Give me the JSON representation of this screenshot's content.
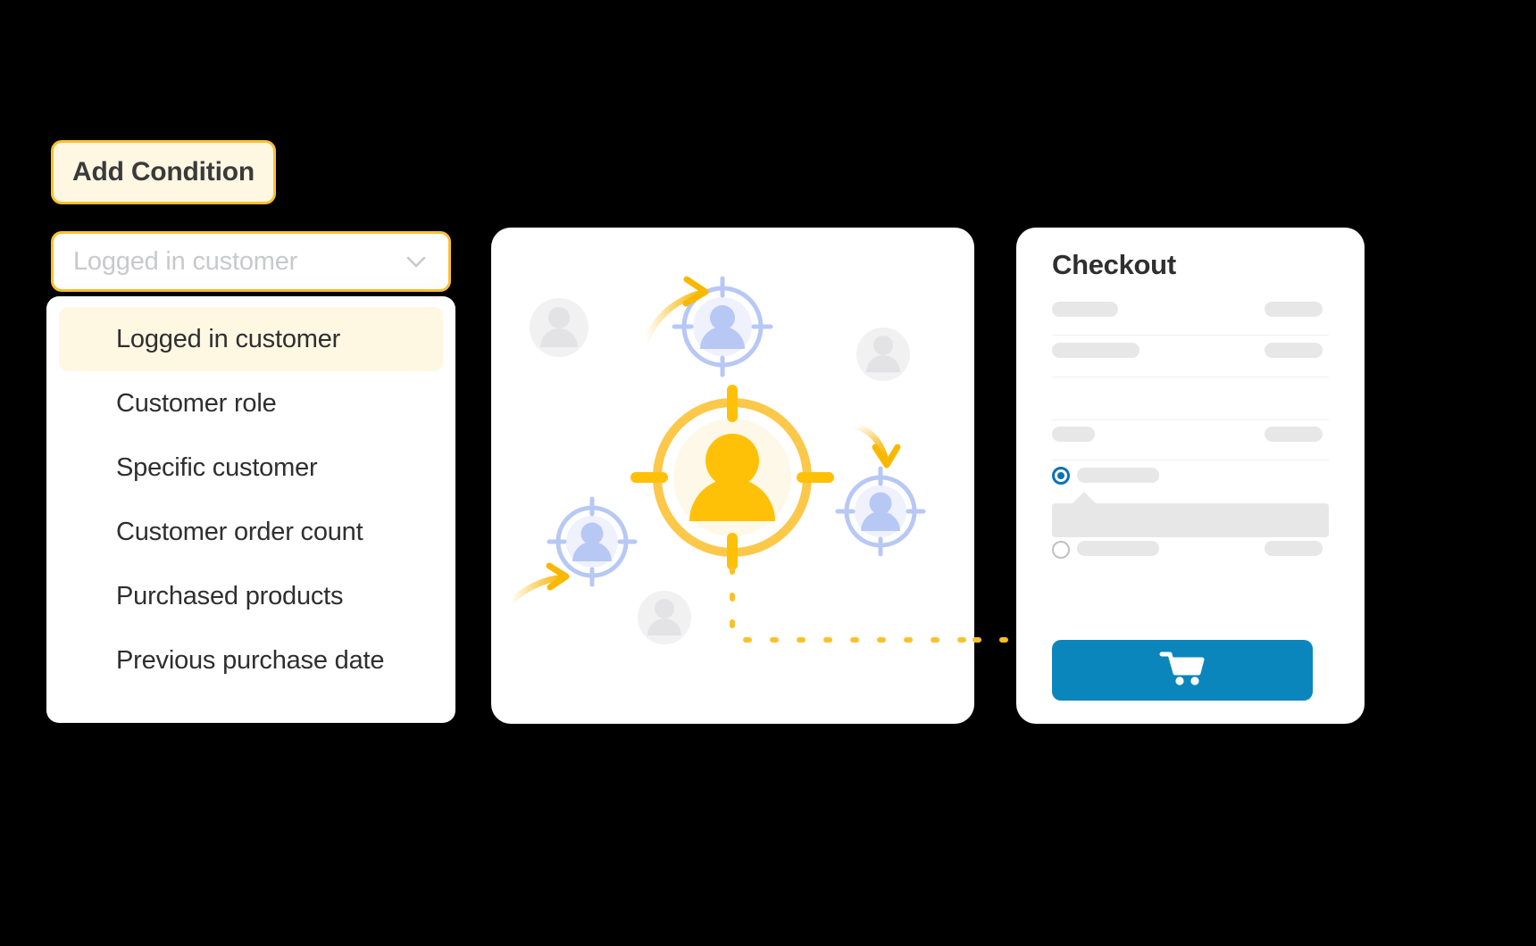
{
  "condition_builder": {
    "add_button_label": "Add Condition",
    "select": {
      "value": "Logged in customer",
      "placeholder": "Logged in customer",
      "chevron_icon": "chevron-down-icon"
    },
    "dropdown": {
      "selected_index": 0,
      "options": [
        "Logged in customer",
        "Customer role",
        "Specific customer",
        "Customer order count",
        "Purchased products",
        "Previous purchase date"
      ]
    }
  },
  "illustration": {
    "name": "customer-targeting-illustration",
    "primary_target_icon": "target-person-icon",
    "secondary_target_icons": [
      "target-person-icon",
      "target-person-icon",
      "target-person-icon"
    ],
    "ghost_avatar_icons": [
      "avatar-icon",
      "avatar-icon",
      "avatar-icon"
    ],
    "arrow_icons": [
      "curved-arrow-icon",
      "curved-arrow-icon",
      "curved-arrow-icon"
    ],
    "connector": "dashed-connector-line"
  },
  "checkout": {
    "title": "Checkout",
    "cart_icon": "shopping-cart-icon",
    "radio_selected_index": 0,
    "rows": 4
  },
  "colors": {
    "accent_yellow": "#FBC02D",
    "accent_yellow_soft": "#FDD14D",
    "accent_yellow_pale": "#FEF7E2",
    "periwinkle": "#B7C8F5",
    "periwinkle_pale": "#EFF1FC",
    "checkout_blue": "#0B86BC",
    "radio_blue": "#0B72B5",
    "skeleton_gray": "#E7E7E8",
    "text_dark": "#2F2F2F",
    "text_muted": "#C8C9CC",
    "background": "#000000",
    "card_white": "#FFFFFF"
  }
}
